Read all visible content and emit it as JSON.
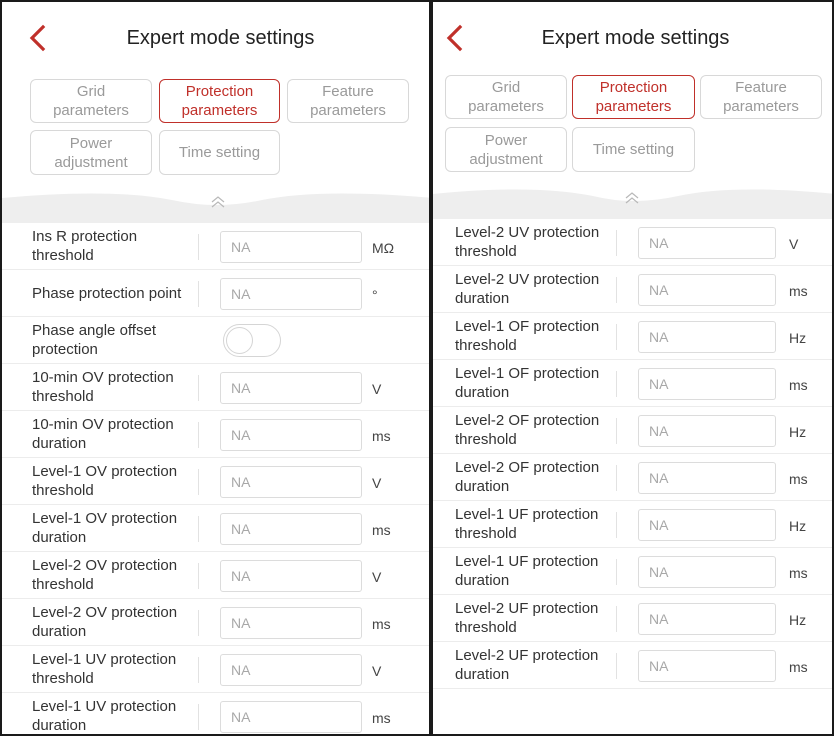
{
  "colors": {
    "accent": "#c0302a",
    "border": "#d8d8d8",
    "collapse_bar": "#eeeeee"
  },
  "icons": {
    "back": "chevron-left-icon",
    "collapse": "double-chevron-up-icon"
  },
  "left": {
    "title": "Expert mode settings",
    "tabs": [
      {
        "label": "Grid\nparameters",
        "active": false
      },
      {
        "label": "Protection\nparameters",
        "active": true
      },
      {
        "label": "Feature\nparameters",
        "active": false
      },
      {
        "label": "Power\nadjustment",
        "active": false
      },
      {
        "label": "Time setting",
        "active": false
      }
    ],
    "rows": [
      {
        "label": "Ins R protection\nthreshold",
        "value": "NA",
        "unit": "MΩ"
      },
      {
        "label": "Phase protection point",
        "value": "NA",
        "unit": "°"
      },
      {
        "label": "Phase angle offset\nprotection",
        "toggle": "off"
      },
      {
        "label": "10-min OV protection\nthreshold",
        "value": "NA",
        "unit": "V"
      },
      {
        "label": "10-min OV protection\nduration",
        "value": "NA",
        "unit": "ms"
      },
      {
        "label": "Level-1 OV protection\nthreshold",
        "value": "NA",
        "unit": "V"
      },
      {
        "label": "Level-1 OV protection\nduration",
        "value": "NA",
        "unit": "ms"
      },
      {
        "label": "Level-2 OV protection\nthreshold",
        "value": "NA",
        "unit": "V"
      },
      {
        "label": "Level-2 OV protection\nduration",
        "value": "NA",
        "unit": "ms"
      },
      {
        "label": "Level-1 UV protection\nthreshold",
        "value": "NA",
        "unit": "V"
      },
      {
        "label": "Level-1 UV protection\nduration",
        "value": "NA",
        "unit": "ms"
      }
    ]
  },
  "right": {
    "title": "Expert mode settings",
    "tabs": [
      {
        "label": "Grid\nparameters",
        "active": false
      },
      {
        "label": "Protection\nparameters",
        "active": true
      },
      {
        "label": "Feature\nparameters",
        "active": false
      },
      {
        "label": "Power\nadjustment",
        "active": false
      },
      {
        "label": "Time setting",
        "active": false
      }
    ],
    "rows": [
      {
        "label": "Level-2 UV protection\nthreshold",
        "value": "NA",
        "unit": "V"
      },
      {
        "label": "Level-2 UV protection\nduration",
        "value": "NA",
        "unit": "ms"
      },
      {
        "label": "Level-1 OF protection\nthreshold",
        "value": "NA",
        "unit": "Hz"
      },
      {
        "label": "Level-1 OF protection\nduration",
        "value": "NA",
        "unit": "ms"
      },
      {
        "label": "Level-2 OF protection\nthreshold",
        "value": "NA",
        "unit": "Hz"
      },
      {
        "label": "Level-2 OF protection\nduration",
        "value": "NA",
        "unit": "ms"
      },
      {
        "label": "Level-1 UF protection\nthreshold",
        "value": "NA",
        "unit": "Hz"
      },
      {
        "label": "Level-1 UF protection\nduration",
        "value": "NA",
        "unit": "ms"
      },
      {
        "label": "Level-2 UF protection\nthreshold",
        "value": "NA",
        "unit": "Hz"
      },
      {
        "label": "Level-2 UF protection\nduration",
        "value": "NA",
        "unit": "ms"
      }
    ]
  }
}
